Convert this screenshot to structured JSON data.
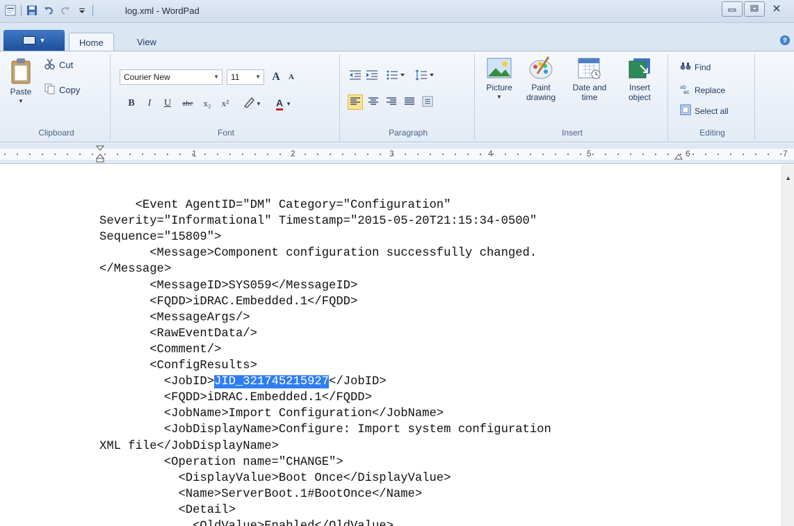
{
  "window": {
    "title": "log.xml - WordPad",
    "buttons": {
      "minimize_icon": "minimize-icon",
      "maximize_icon": "maximize-icon",
      "close_icon": "close-icon"
    }
  },
  "tabs": [
    {
      "label": "Home",
      "active": true
    },
    {
      "label": "View",
      "active": false
    }
  ],
  "ribbon": {
    "clipboard": {
      "label": "Clipboard",
      "paste": "Paste",
      "cut": "Cut",
      "copy": "Copy"
    },
    "font": {
      "label": "Font",
      "family": "Courier New",
      "size": "11",
      "bold": "B",
      "italic": "I",
      "underline": "U",
      "strike": "abc",
      "subscript": "x₂",
      "superscript": "x²",
      "grow": "A",
      "shrink": "A",
      "color": "A"
    },
    "paragraph": {
      "label": "Paragraph"
    },
    "insert": {
      "label": "Insert",
      "picture": "Picture",
      "paint_1": "Paint",
      "paint_2": "drawing",
      "datetime_1": "Date and",
      "datetime_2": "time",
      "object_1": "Insert",
      "object_2": "object"
    },
    "editing": {
      "label": "Editing",
      "find": "Find",
      "replace": "Replace",
      "select_all": "Select all"
    }
  },
  "ruler": {
    "numbers": [
      "1",
      "2",
      "3",
      "4",
      "5",
      "6",
      "7"
    ]
  },
  "document": {
    "lines": [
      "     <Event AgentID=\"DM\" Category=\"Configuration\"",
      "Severity=\"Informational\" Timestamp=\"2015-05-20T21:15:34-0500\"",
      "Sequence=\"15809\">",
      "       <Message>Component configuration successfully changed.",
      "</Message>",
      "       <MessageID>SYS059</MessageID>",
      "       <FQDD>iDRAC.Embedded.1</FQDD>",
      "       <MessageArgs/>",
      "       <RawEventData/>",
      "       <Comment/>",
      "       <ConfigResults>",
      "         <JobID>",
      "         <FQDD>iDRAC.Embedded.1</FQDD>",
      "         <JobName>Import Configuration</JobName>",
      "         <JobDisplayName>Configure: Import system configuration",
      "XML file</JobDisplayName>",
      "         <Operation name=\"CHANGE\">",
      "           <DisplayValue>Boot Once</DisplayValue>",
      "           <Name>ServerBoot.1#BootOnce</Name>",
      "           <Detail>",
      "             <OldValue>Enabled</OldValue>"
    ],
    "selected_text": "JID_321745215927",
    "after_selection": "</JobID>"
  }
}
